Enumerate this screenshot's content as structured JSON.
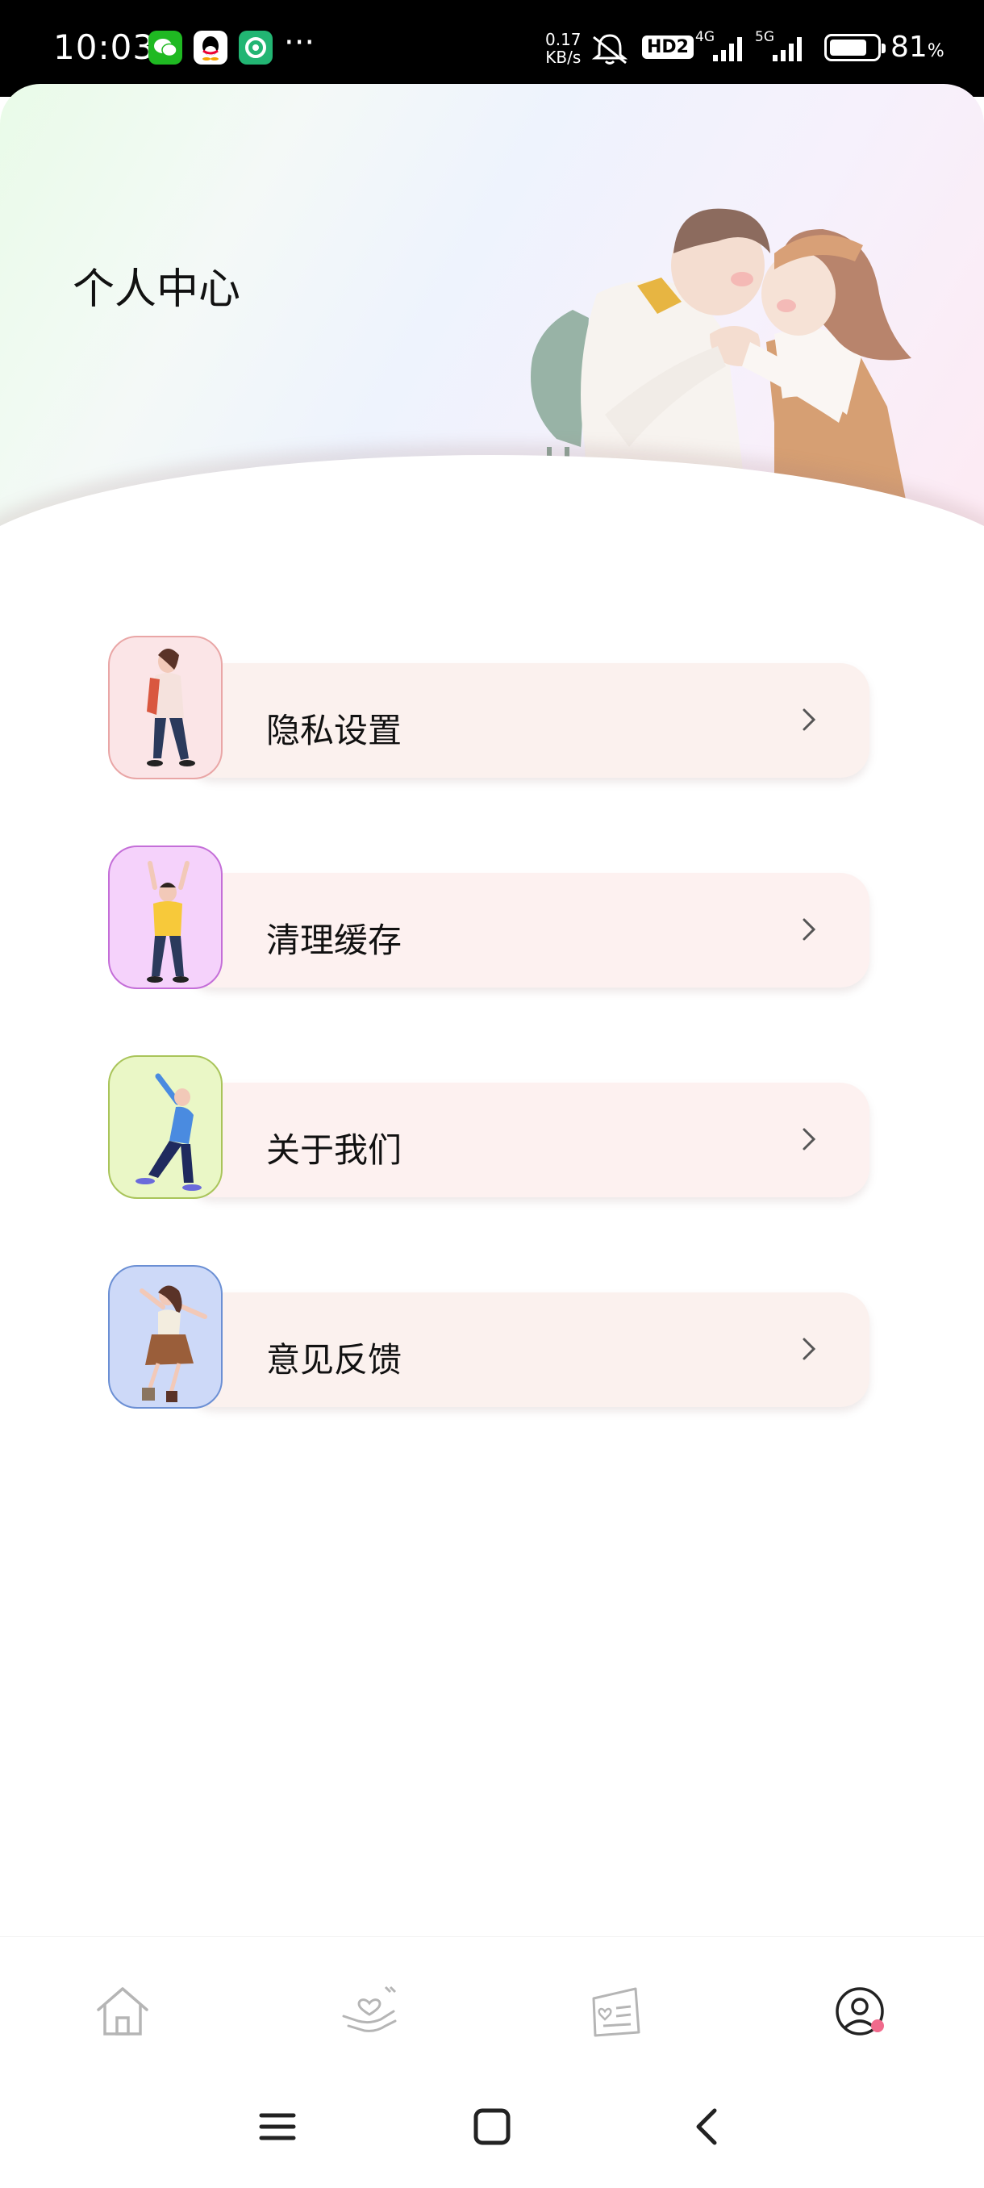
{
  "status_bar": {
    "time": "10:03",
    "notifications": [
      "wechat-icon",
      "qq-icon",
      "app-icon"
    ],
    "more": "···",
    "net_speed_value": "0.17",
    "net_speed_unit": "KB/s",
    "hd_badge": "HD2",
    "signal_1": "4G",
    "signal_2": "5G",
    "battery_level": 0.81,
    "battery_percent": "81",
    "battery_percent_sign": "%"
  },
  "header": {
    "title": "个人中心"
  },
  "menu": [
    {
      "label": "隐私设置",
      "icon": "walking-girl-illustration",
      "thumb_bg": "#fbe5e7",
      "thumb_border": "#e9a6a6"
    },
    {
      "label": "清理缓存",
      "icon": "cheering-boy-illustration",
      "thumb_bg": "#f5d2fb",
      "thumb_border": "#c46ed8"
    },
    {
      "label": "关于我们",
      "icon": "dancing-man-illustration",
      "thumb_bg": "#eaf7c6",
      "thumb_border": "#a9c45a"
    },
    {
      "label": "意见反馈",
      "icon": "jumping-girl-illustration",
      "thumb_bg": "#cdd9f8",
      "thumb_border": "#6b8fd4"
    }
  ],
  "bottom_nav": [
    {
      "icon": "home-icon",
      "active": false
    },
    {
      "icon": "heart-hands-icon",
      "active": false
    },
    {
      "icon": "love-letter-icon",
      "active": false
    },
    {
      "icon": "profile-icon",
      "active": true
    }
  ],
  "colors": {
    "accent": "#f06a8c",
    "nav_inactive": "#b5b5b5"
  }
}
